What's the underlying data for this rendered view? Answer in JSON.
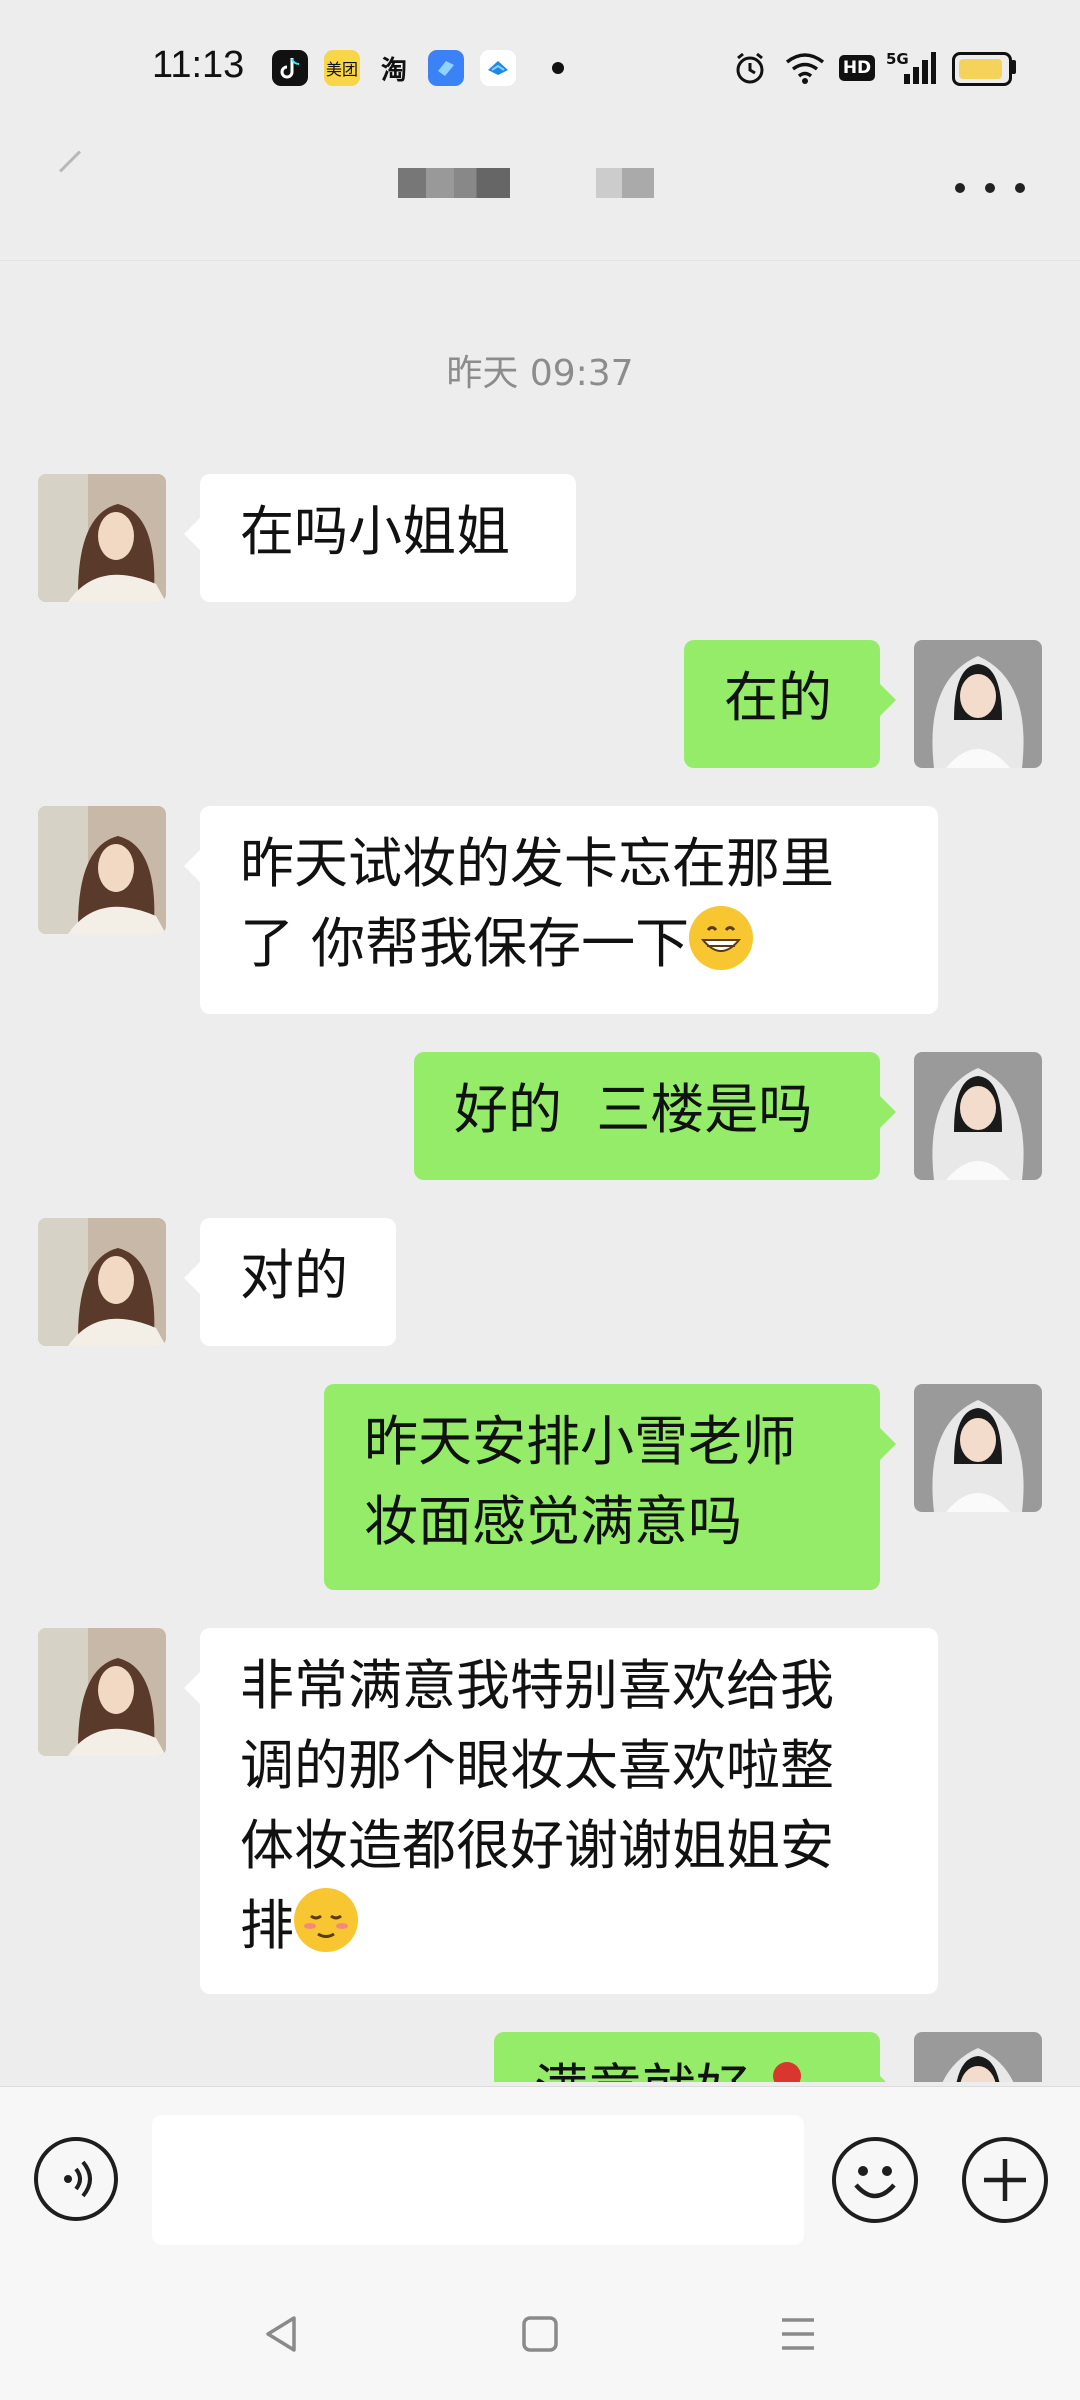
{
  "status_bar": {
    "time": "11:13",
    "app_icons": [
      {
        "name": "douyin-icon",
        "label": "",
        "bg": "#111111",
        "fg": "#ffffff"
      },
      {
        "name": "meituan-icon",
        "label": "美团",
        "bg": "#f9d548",
        "fg": "#111111"
      },
      {
        "name": "taobao-icon",
        "label": "淘",
        "bg": "#ededed",
        "fg": "#111111"
      },
      {
        "name": "feishu-icon",
        "label": "",
        "bg": "#3b82f6",
        "fg": "#ffffff"
      },
      {
        "name": "zhifubao-icon",
        "label": "",
        "bg": "#ffffff",
        "fg": "#1e88e5"
      }
    ],
    "network": "5G",
    "hd_label": "HD"
  },
  "header": {
    "title": "",
    "more_icon": "more-dots-icon"
  },
  "chat": {
    "timestamp": "昨天 09:37",
    "messages": [
      {
        "side": "in",
        "text": "在吗小姐姐"
      },
      {
        "side": "out",
        "text": "在的"
      },
      {
        "side": "in",
        "lines": [
          "昨天试妆的发卡忘在那里",
          "了 你帮我保存一下"
        ],
        "emoji": "grinning-emoji"
      },
      {
        "side": "out",
        "text": "好的  三楼是吗"
      },
      {
        "side": "in",
        "text": "对的"
      },
      {
        "side": "out",
        "lines": [
          "昨天安排小雪老师",
          "妆面感觉满意吗"
        ]
      },
      {
        "side": "in",
        "lines": [
          "非常满意我特别喜欢给我",
          "调的那个眼妆太喜欢啦整",
          "体妆造都很好谢谢姐姐安",
          "排"
        ],
        "emoji": "relieved-emoji"
      },
      {
        "side": "out",
        "text": "满意就好",
        "emoji": "rose-emoji"
      }
    ]
  },
  "input_bar": {
    "voice_icon": "voice-icon",
    "emoji_icon": "smiley-icon",
    "plus_icon": "plus-icon",
    "placeholder": ""
  },
  "colors": {
    "outgoing_bubble": "#95ec69",
    "incoming_bubble": "#ffffff",
    "background": "#ededed"
  }
}
